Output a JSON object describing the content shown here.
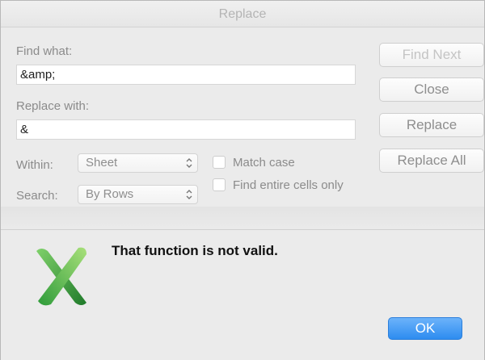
{
  "window": {
    "title": "Replace"
  },
  "find": {
    "label": "Find what:",
    "value": "&amp;"
  },
  "replace": {
    "label": "Replace with:",
    "value": "&"
  },
  "within": {
    "label": "Within:",
    "selected": "Sheet"
  },
  "search": {
    "label": "Search:",
    "selected": "By Rows"
  },
  "options": {
    "match_case": "Match case",
    "entire_cells": "Find entire cells only"
  },
  "buttons": {
    "find_next": "Find Next",
    "close": "Close",
    "replace": "Replace",
    "replace_all": "Replace All"
  },
  "alert": {
    "message": "That function is not valid.",
    "ok": "OK",
    "icon": "excel-icon"
  },
  "colors": {
    "accent": "#2d8cf0",
    "excel_green": "#2e9b3a"
  }
}
